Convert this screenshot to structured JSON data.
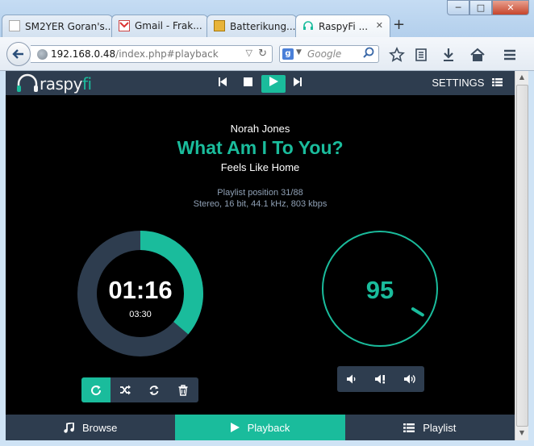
{
  "browser": {
    "tabs": [
      {
        "label": "SM2YER Goran's..."
      },
      {
        "label": "Gmail - Frak..."
      },
      {
        "label": "Batterikung..."
      },
      {
        "label": "RaspyFi ..."
      }
    ],
    "url_host": "192.168.0.48",
    "url_path": "/index.php#playback",
    "search_placeholder": "Google",
    "new_tab": "+",
    "window_buttons": {
      "minimize": "─",
      "maximize": "□",
      "close": "✕"
    }
  },
  "app": {
    "logo_prefix": "raspy",
    "logo_suffix": "fi",
    "settings_label": "SETTINGS",
    "now_playing": {
      "artist": "Norah Jones",
      "title": "What Am I To You?",
      "album": "Feels Like Home",
      "playlist_position": "Playlist position 31/88",
      "format": "Stereo, 16 bit, 44.1 kHz, 803 kbps"
    },
    "timer": {
      "elapsed": "01:16",
      "total": "03:30",
      "progress_fraction": 0.362
    },
    "volume": {
      "value": "95",
      "level_fraction": 0.95
    },
    "footer": {
      "browse": "Browse",
      "playback": "Playback",
      "playlist": "Playlist"
    },
    "colors": {
      "accent": "#1abc9c",
      "panel": "#2e3d4f",
      "background": "#000000"
    }
  }
}
